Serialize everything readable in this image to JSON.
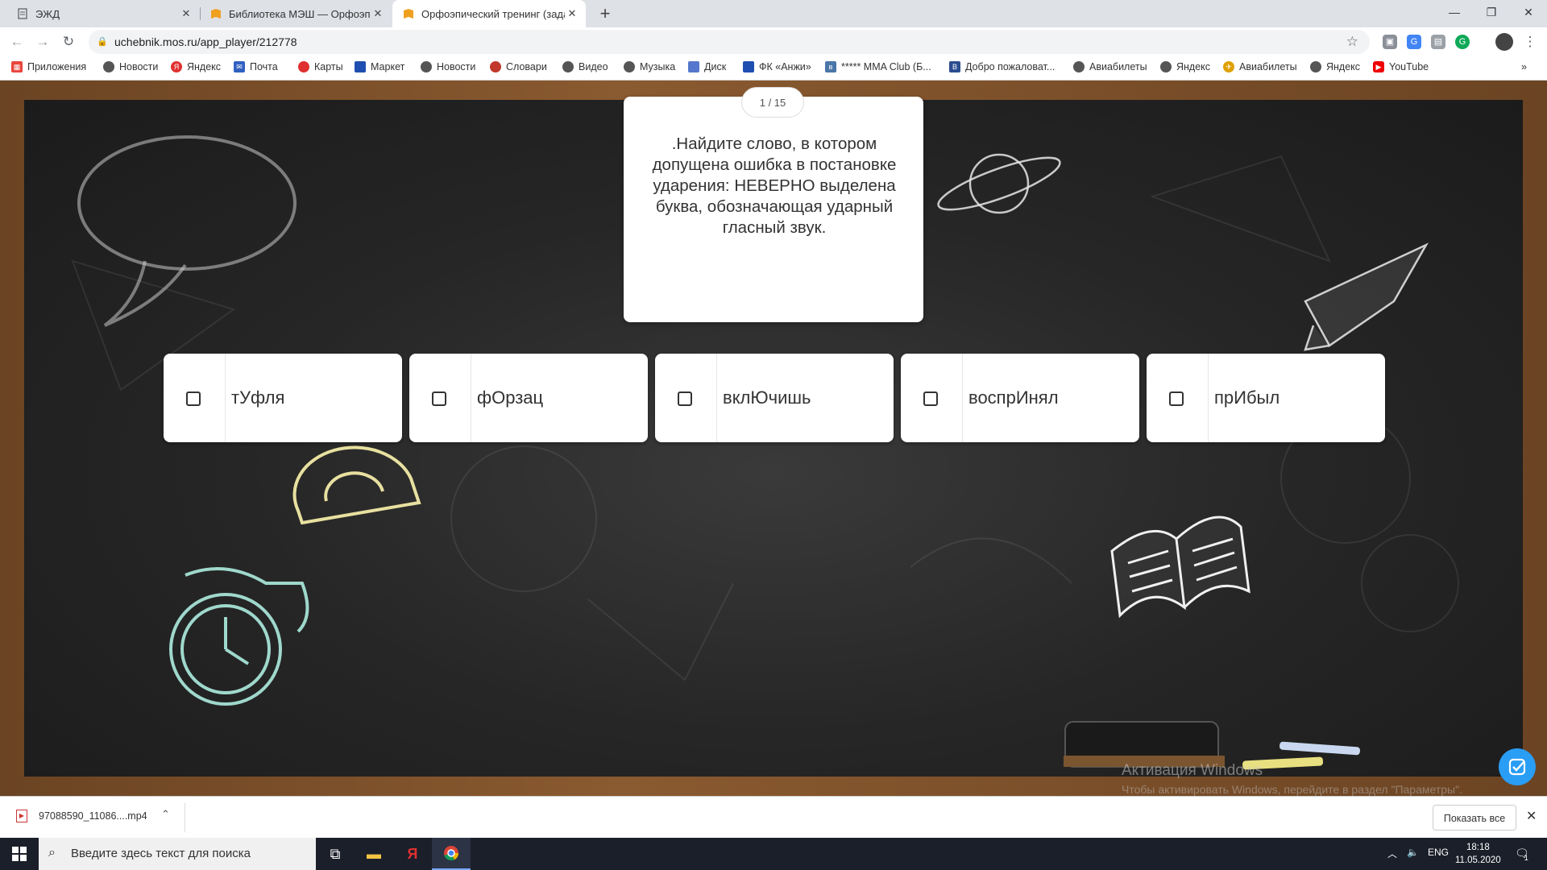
{
  "browser": {
    "tabs": [
      {
        "title": "ЭЖД",
        "icon": "document-icon"
      },
      {
        "title": "Библиотека МЭШ — Орфоэпи",
        "icon": "mesh-book-icon"
      },
      {
        "title": "Орфоэпический тренинг (задан",
        "icon": "mesh-book-icon",
        "active": true
      }
    ],
    "url": "uchebnik.mos.ru/app_player/212778",
    "bookmarks": [
      "Приложения",
      "Новости",
      "Яндекс",
      "Почта",
      "Карты",
      "Маркет",
      "Новости",
      "Словари",
      "Видео",
      "Музыка",
      "Диск",
      "ФК «Анжи»",
      "***** MMA Club (Б...",
      "Добро пожаловат...",
      "Авиабилеты",
      "Яндекс",
      "Авиабилеты",
      "Яндекс",
      "YouTube"
    ],
    "bookmarks_overflow": "»"
  },
  "quiz": {
    "counter": "1 / 15",
    "question": ".Найдите слово, в котором допущена ошибка в постановке ударения: НЕВЕРНО выделена буква, обозначающая ударный гласный звук.",
    "answers": [
      "тУфля",
      "фОрзац",
      "вклЮчишь",
      "воспрИнял",
      "прИбыл"
    ]
  },
  "watermark": {
    "line1": "Активация Windows",
    "line2": "Чтобы активировать Windows, перейдите в раздел \"Параметры\"."
  },
  "downloads": {
    "file": "97088590_11086....mp4",
    "show_all": "Показать все"
  },
  "taskbar": {
    "search_placeholder": "Введите здесь текст для поиска",
    "lang": "ENG",
    "time": "18:18",
    "date": "11.05.2020",
    "notification_count": "1"
  },
  "colors": {
    "accent": "#2a9df4",
    "board": "#262626",
    "frame": "#6b4423"
  }
}
